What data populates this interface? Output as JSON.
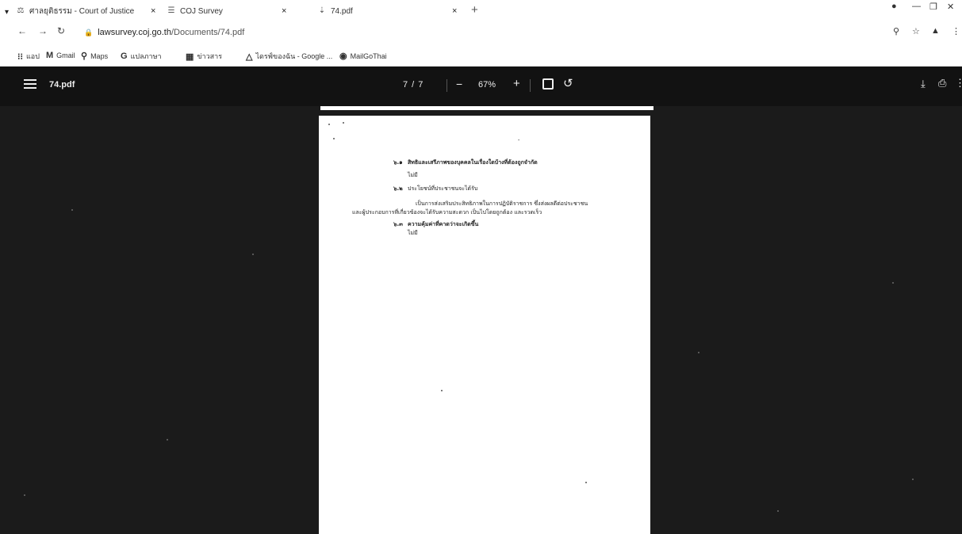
{
  "browser": {
    "tabs": [
      {
        "label": "ศาลยุติธรรม - Court of Justice",
        "favicon": "court-icon"
      },
      {
        "label": "COJ Survey",
        "favicon": "survey-icon"
      },
      {
        "label": "74.pdf",
        "favicon": "pdf-icon"
      }
    ],
    "new_tab": "+",
    "url_domain": "lawsurvey.coj.go.th",
    "url_path": "/Documents/74.pdf"
  },
  "bookmarks": [
    {
      "label": "แอป",
      "icon": "apps-grid-icon"
    },
    {
      "label": "Gmail",
      "icon": "gmail-icon"
    },
    {
      "label": "Maps",
      "icon": "maps-pin-icon"
    },
    {
      "label": "แปลภาษา",
      "icon": "translate-icon"
    },
    {
      "label": "ข่าวสาร",
      "icon": "news-icon"
    },
    {
      "label": "ไดรฟ์ของฉัน - Google ...",
      "icon": "drive-icon"
    },
    {
      "label": "MailGoThai",
      "icon": "mail-icon"
    }
  ],
  "pdf": {
    "title": "74.pdf",
    "page_indicator": "7 / 7",
    "zoom": "67%",
    "zoom_out": "−",
    "zoom_in": "+"
  },
  "page_content": {
    "items": [
      {
        "num": "๖.๑",
        "heading": "สิทธิและเสรีภาพของบุคคลในเรื่องใดบ้างที่ต้องถูกจำกัด",
        "answer": "ไม่มี"
      },
      {
        "num": "๖.๒",
        "heading": "ประโยชน์ที่ประชาชนจะได้รับ",
        "answer": "เป็นการส่งเสริมประสิทธิภาพในการปฏิบัติราชการ ซึ่งส่งผลดีต่อประชาชน",
        "answer2": "และผู้ประกอบการที่เกี่ยวข้องจะได้รับความสะดวก เป็นไปโดยถูกต้อง และรวดเร็ว"
      },
      {
        "num": "๖.๓",
        "heading": "ความคุ้มค่าที่คาดว่าจะเกิดขึ้น",
        "answer": "ไม่มี"
      }
    ]
  },
  "colors": {
    "viewer_bg": "#1b1b1b",
    "toolbar_bg": "#121212",
    "page_bg": "#ffffff"
  }
}
